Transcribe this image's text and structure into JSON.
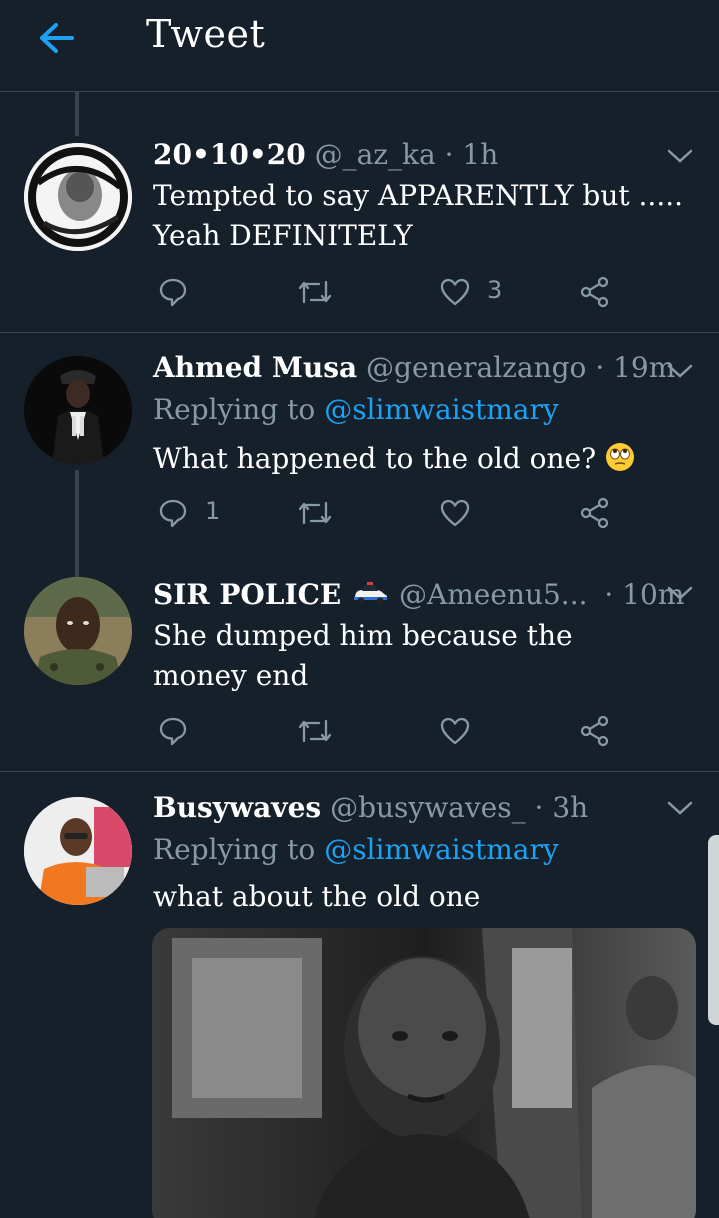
{
  "header": {
    "title": "Tweet"
  },
  "colors": {
    "background": "#15202b",
    "accent": "#1da1f2",
    "muted": "#8899a6",
    "divider": "#38444d"
  },
  "tweets": [
    {
      "name": "20•10•20",
      "handle": "@_az_ka",
      "time": "· 1h",
      "body": "Tempted to say APPARENTLY but ..... Yeah DEFINITELY",
      "reply_count": "",
      "like_count": "3"
    },
    {
      "name": "Ahmed Musa",
      "handle": "@generalzango",
      "time": "· 19m",
      "replying_prefix": "Replying to",
      "replying_to": "@slimwaistmary",
      "body": "What happened to the old one?",
      "emoji": "face-with-rolling-eyes-icon",
      "reply_count": "1",
      "like_count": ""
    },
    {
      "name": "SIR POLICE",
      "name_emoji": "police-car-icon",
      "handle": "@Ameenu5...",
      "time": "· 10m",
      "body": "She dumped him because the money end",
      "reply_count": "",
      "like_count": ""
    },
    {
      "name": "Busywaves",
      "handle": "@busywaves_",
      "time": "· 3h",
      "replying_prefix": "Replying to",
      "replying_to": "@slimwaistmary",
      "body": "what about the old one",
      "media": "photo"
    }
  ]
}
